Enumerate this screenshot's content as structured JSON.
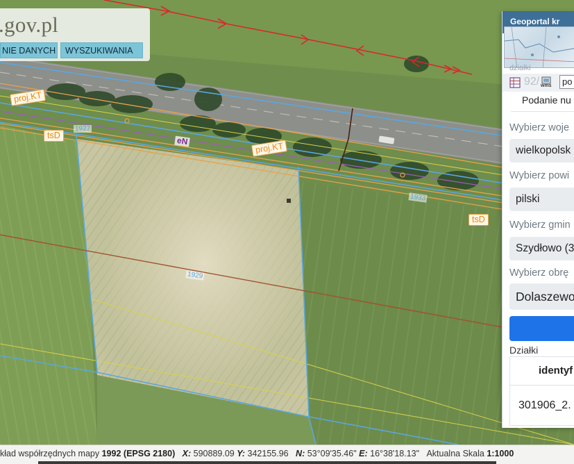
{
  "logo": {
    "text": ".gov.pl"
  },
  "nav": {
    "btn1": "NIE DANYCH",
    "btn2": "WYSZUKIWANIA"
  },
  "map_labels": {
    "proj_kt_1": "proj.KT",
    "proj_kt_2": "proj.KT",
    "tsd_1": "tsD",
    "tsd_2": "tsD",
    "en": "eN",
    "parcel_1927": "1927",
    "parcel_1933": "1933",
    "parcel_1929": "1929"
  },
  "panel": {
    "title": "Geoportal kr",
    "subtitle": "działki",
    "tools_text": "92/",
    "tools_icon2": "wms",
    "tools_input": "po",
    "tab_label": "Podanie nu",
    "fields": [
      {
        "label": "Wybierz woje",
        "value": "wielkopolsk"
      },
      {
        "label": "Wybierz powi",
        "value": "pilski"
      },
      {
        "label": "Wybierz gmin",
        "value": "Szydłowo (3"
      },
      {
        "label": "Wybierz obrę",
        "value": "Dolaszewo"
      }
    ],
    "section": "Działki",
    "table_header": "identyf",
    "table_value": "301906_2."
  },
  "status": {
    "prefix": "kład współrzędnych mapy ",
    "crs_code": "1992",
    "crs_epsg": "(EPSG 2180)",
    "x_label": "X:",
    "x_value": "590889.09",
    "y_label": "Y:",
    "y_value": "342155.96",
    "n_label": "N:",
    "n_value": "53°09'35.46\"",
    "e_label": "E:",
    "e_value": "16°38'18.13\"",
    "scale_label": "Aktualna Skala",
    "scale_value": "1:1000"
  },
  "colors": {
    "parcel_line": "#5aa7e0",
    "boundary_orange": "#e8a24a",
    "red_line": "#d8282c",
    "brown_line": "#a0522d",
    "panel_header": "#3d6f98",
    "primary_button": "#1e73e8"
  }
}
